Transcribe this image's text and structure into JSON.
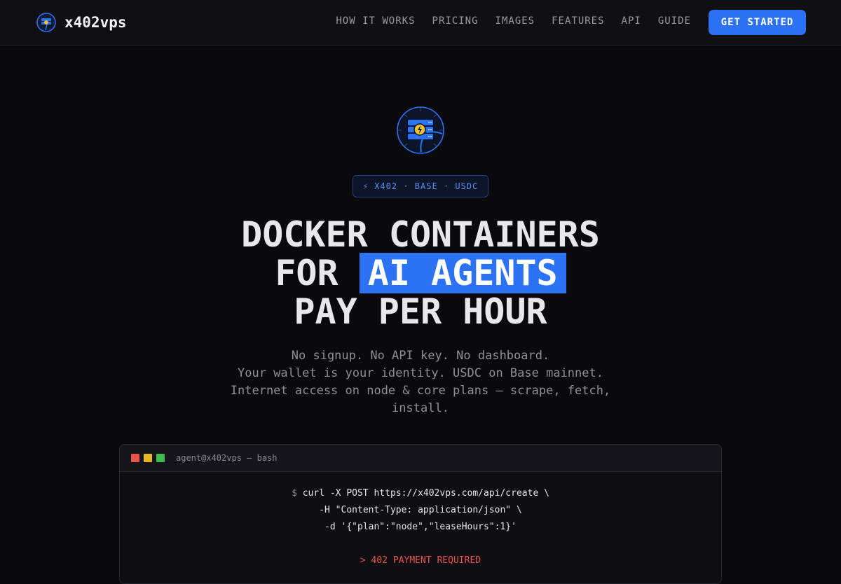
{
  "nav": {
    "brand": "x402vps",
    "links": [
      "HOW IT WORKS",
      "PRICING",
      "IMAGES",
      "FEATURES",
      "API",
      "GUIDE"
    ],
    "cta": "GET STARTED"
  },
  "hero": {
    "badge": "⚡ X402 · BASE · USDC",
    "headline_line1": "DOCKER CONTAINERS",
    "headline_line2_prefix": "FOR",
    "headline_line2_highlight": "AI AGENTS",
    "headline_line3": "PAY PER HOUR",
    "sub_lines": [
      "No signup. No API key. No dashboard.",
      "Your wallet is your identity. USDC on Base mainnet.",
      "Internet access on node & core plans — scrape, fetch, install."
    ]
  },
  "terminal": {
    "title": "agent@x402vps — bash",
    "prompt": "$",
    "lines": [
      "curl -X POST https://x402vps.com/api/create \\",
      "-H \"Content-Type: application/json\" \\",
      "-d '{\"plan\":\"node\",\"leaseHours\":1}'"
    ],
    "response": "> 402 PAYMENT REQUIRED"
  },
  "colors": {
    "accent": "#2b72f5",
    "background": "#0a0a0c",
    "error": "#e5534b"
  },
  "icons": [
    "server-lightning-logo-icon",
    "terminal-window-dots"
  ]
}
